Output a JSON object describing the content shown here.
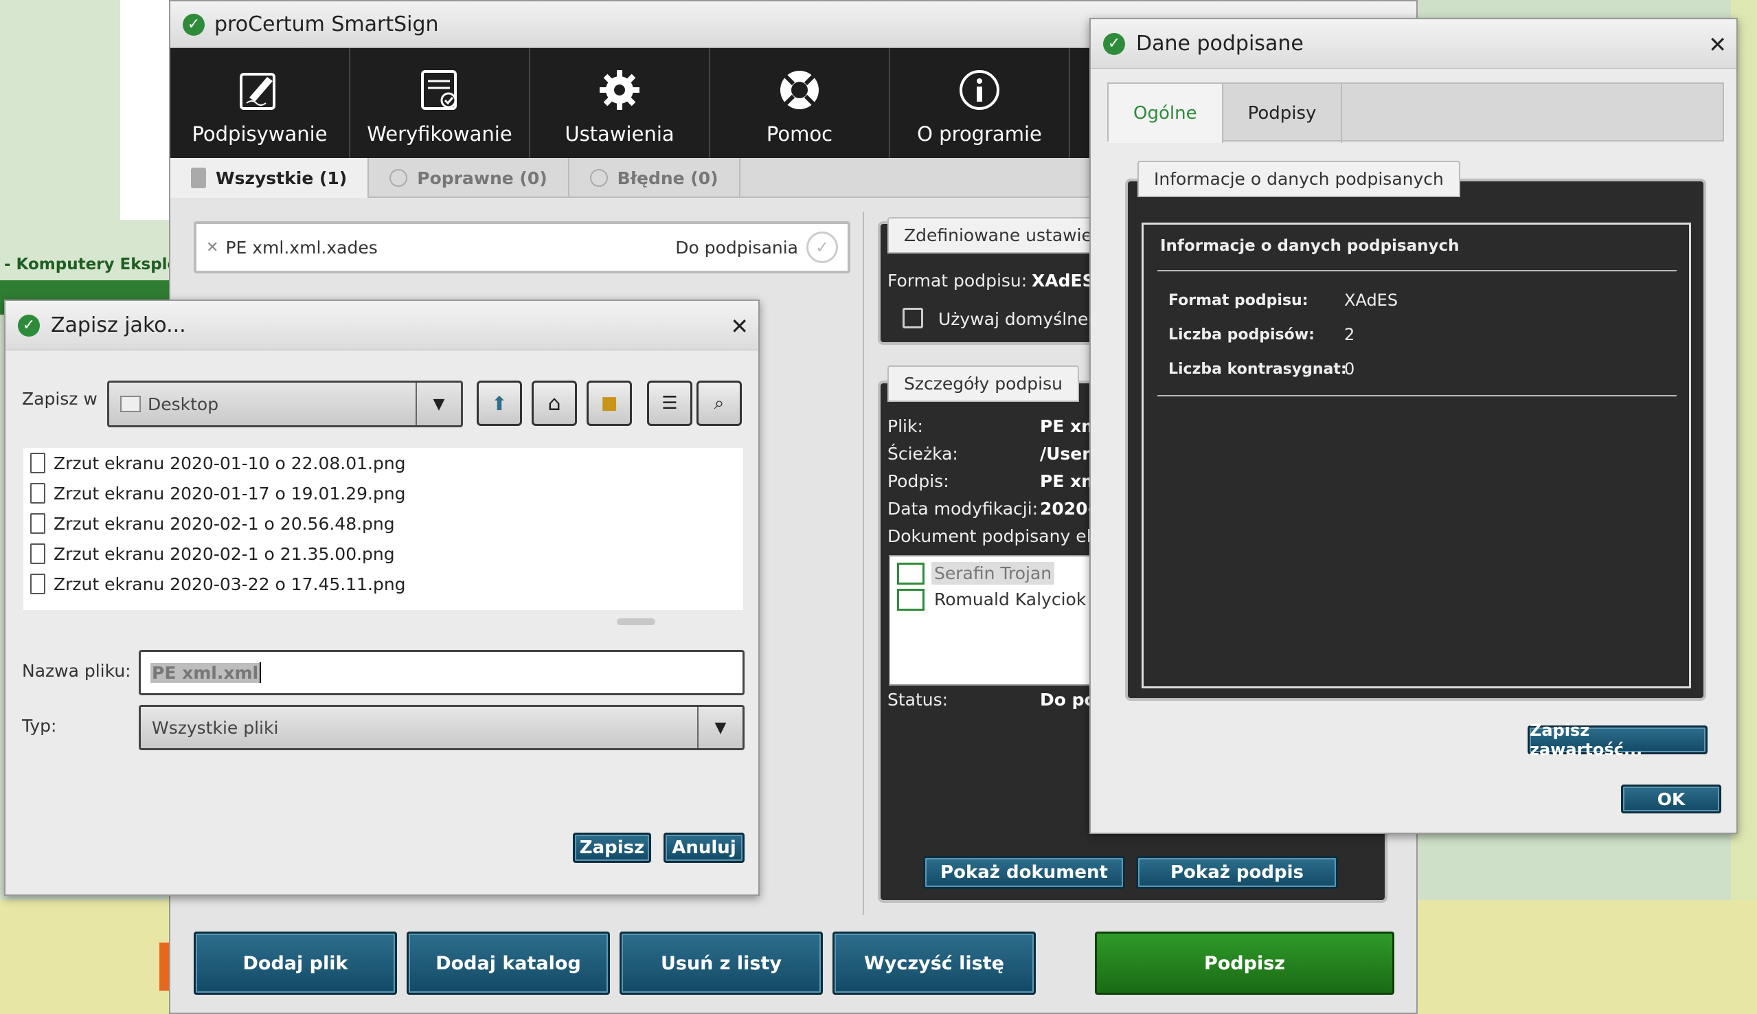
{
  "background": {
    "link_text": "- Komputery Eksploa"
  },
  "main_window": {
    "title": "proCertum SmartSign",
    "toolbar": [
      {
        "label": "Podpisywanie",
        "icon": "sign-icon"
      },
      {
        "label": "Weryfikowanie",
        "icon": "verify-icon"
      },
      {
        "label": "Ustawienia",
        "icon": "gear-icon"
      },
      {
        "label": "Pomoc",
        "icon": "lifebuoy-icon"
      },
      {
        "label": "O programie",
        "icon": "info-icon"
      }
    ],
    "filter_tabs": [
      {
        "label": "Wszystkie (1)"
      },
      {
        "label": "Poprawne (0)"
      },
      {
        "label": "Błędne (0)"
      }
    ],
    "file_item": {
      "name": "PE xml.xml.xades",
      "status": "Do podpisania"
    },
    "settings_panel": {
      "tab": "Zdefiniowane ustawien",
      "format_label": "Format podpisu:",
      "format_value": "XAdES",
      "default_checkbox": "Używaj domyślnego"
    },
    "details_panel": {
      "tab": "Szczegóły podpisu",
      "rows": [
        {
          "label": "Plik:",
          "value": "PE xm"
        },
        {
          "label": "Ścieżka:",
          "value": "/User"
        },
        {
          "label": "Podpis:",
          "value": "PE xm"
        },
        {
          "label": "Data modyfikacji:",
          "value": "2020-"
        }
      ],
      "signed_by_label": "Dokument podpisany ele",
      "signers": [
        "Serafin Trojan",
        "Romuald Kalyciok"
      ],
      "status_label": "Status:",
      "status_value": "Do po",
      "show_document": "Pokaż dokument",
      "show_signature": "Pokaż podpis"
    },
    "bottom_buttons": {
      "add_file": "Dodaj plik",
      "add_folder": "Dodaj katalog",
      "remove": "Usuń z listy",
      "clear": "Wyczyść listę",
      "sign": "Podpisz"
    }
  },
  "save_dialog": {
    "title": "Zapisz jako...",
    "save_in_label": "Zapisz w",
    "location": "Desktop",
    "files": [
      "Zrzut ekranu 2020-01-10 o 22.08.01.png",
      "Zrzut ekranu 2020-01-17 o 19.01.29.png",
      "Zrzut ekranu 2020-02-1 o 20.56.48.png",
      "Zrzut ekranu 2020-02-1 o 21.35.00.png",
      "Zrzut ekranu 2020-03-22 o 17.45.11.png"
    ],
    "filename_label": "Nazwa pliku:",
    "filename_value": "PE xml.xml",
    "type_label": "Typ:",
    "type_value": "Wszystkie pliki",
    "save_button": "Zapisz",
    "cancel_button": "Anuluj"
  },
  "signed_dialog": {
    "title": "Dane podpisane",
    "tabs": [
      "Ogólne",
      "Podpisy"
    ],
    "group_title": "Informacje o danych podpisanych",
    "inner_title": "Informacje o danych podpisanych",
    "rows": [
      {
        "label": "Format podpisu:",
        "value": "XAdES"
      },
      {
        "label": "Liczba podpisów:",
        "value": "2"
      },
      {
        "label": "Liczba kontrasygnat:",
        "value": "0"
      }
    ],
    "save_content_button": "Zapisz zawartość...",
    "ok_button": "OK"
  }
}
